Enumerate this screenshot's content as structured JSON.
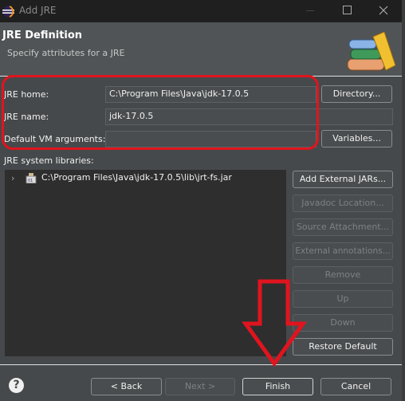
{
  "window": {
    "title": "Add JRE",
    "icon": "eclipse-icon",
    "controls": [
      "minimize",
      "maximize",
      "close"
    ]
  },
  "header": {
    "title": "JRE Definition",
    "subtitle": "Specify attributes for a JRE",
    "icon": "library-books-icon"
  },
  "form": {
    "jre_home": {
      "label": "JRE home:",
      "value": "C:\\Program Files\\Java\\jdk-17.0.5",
      "button": "Directory..."
    },
    "jre_name": {
      "label": "JRE name:",
      "value": "jdk-17.0.5"
    },
    "vm_args": {
      "label": "Default VM arguments:",
      "value": "",
      "button": "Variables..."
    }
  },
  "libraries": {
    "label": "JRE system libraries:",
    "items": [
      {
        "label": "C:\\Program Files\\Java\\jdk-17.0.5\\lib\\jrt-fs.jar",
        "expanded": false
      }
    ]
  },
  "side_buttons": [
    {
      "label": "Add External JARs...",
      "enabled": true
    },
    {
      "label": "Javadoc Location...",
      "enabled": false
    },
    {
      "label": "Source Attachment...",
      "enabled": false
    },
    {
      "label": "External annotations...",
      "enabled": false
    },
    {
      "label": "Remove",
      "enabled": false
    },
    {
      "label": "Up",
      "enabled": false
    },
    {
      "label": "Down",
      "enabled": false
    },
    {
      "label": "Restore Default",
      "enabled": true
    }
  ],
  "footer": {
    "back": "< Back",
    "next": "Next >",
    "finish": "Finish",
    "cancel": "Cancel",
    "help": "?"
  },
  "annotations": {
    "highlight_color": "#e0141e",
    "arrow_target": "Finish"
  }
}
